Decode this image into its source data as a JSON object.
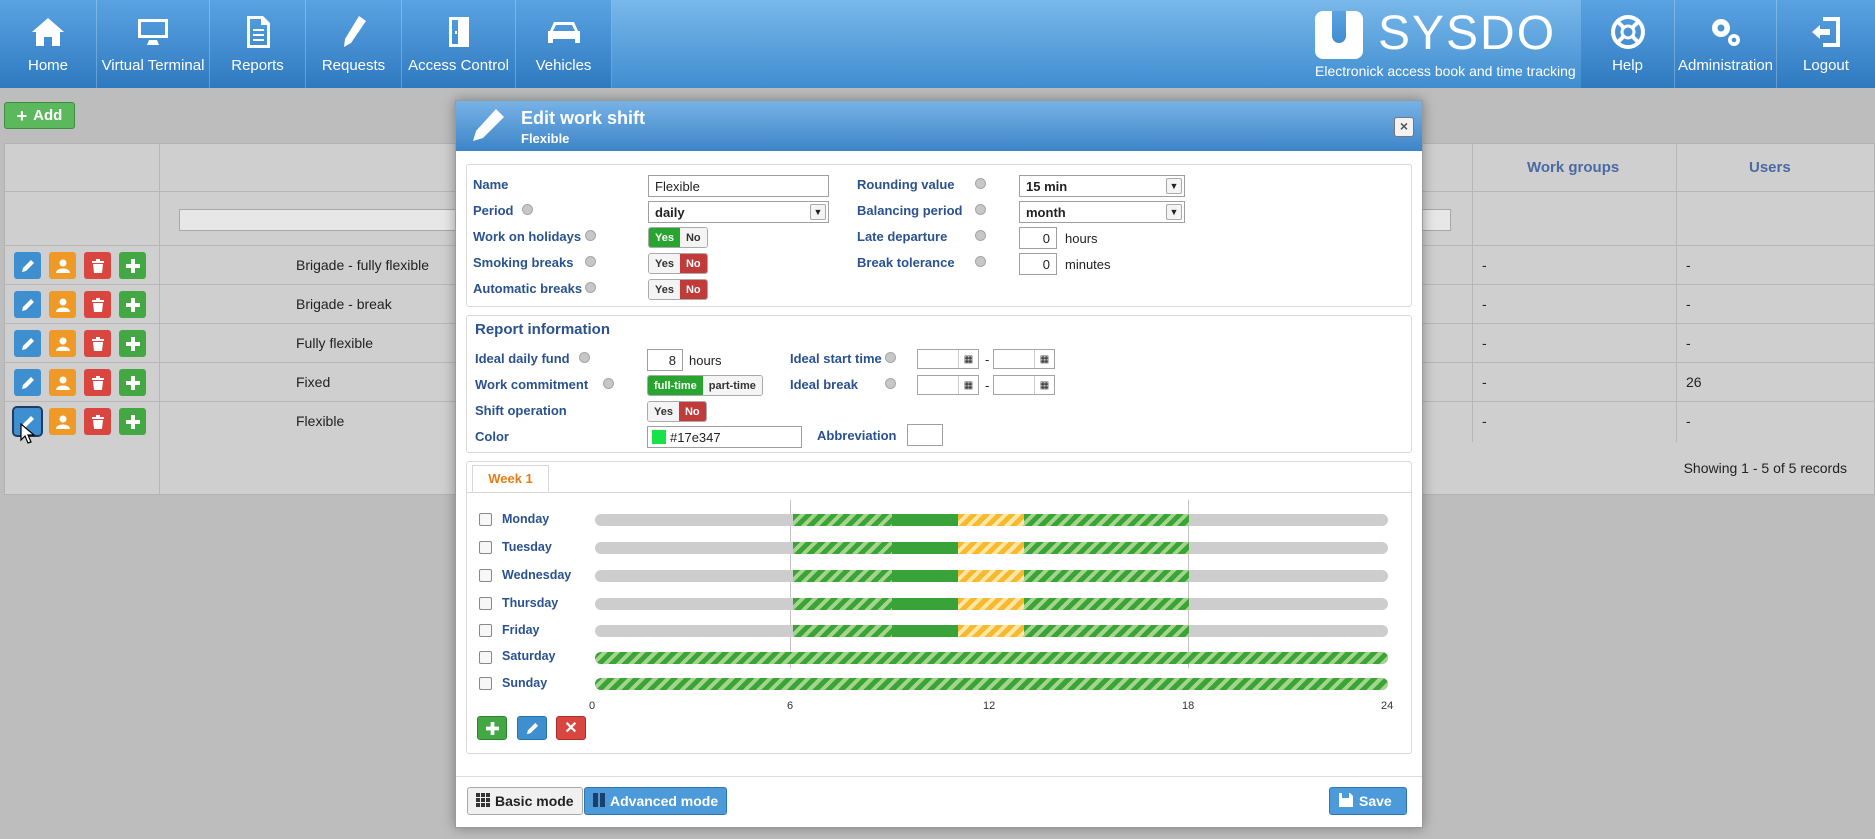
{
  "nav": {
    "items": [
      {
        "label": "Home",
        "icon": "home-icon"
      },
      {
        "label": "Virtual Terminal",
        "icon": "monitor-icon"
      },
      {
        "label": "Reports",
        "icon": "report-icon"
      },
      {
        "label": "Requests",
        "icon": "pencil-icon"
      },
      {
        "label": "Access Control",
        "icon": "door-icon"
      },
      {
        "label": "Vehicles",
        "icon": "car-icon"
      }
    ],
    "right_items": [
      {
        "label": "Help",
        "icon": "lifebuoy-icon"
      },
      {
        "label": "Administration",
        "icon": "gears-icon"
      },
      {
        "label": "Logout",
        "icon": "logout-icon"
      }
    ],
    "brand_name": "SYSDO",
    "brand_tagline": "Electronick access book and time tracking"
  },
  "background": {
    "add_label": "Add",
    "columns": {
      "work_groups": "Work groups",
      "users": "Users"
    },
    "rows": [
      {
        "name": "Brigade - fully flexible",
        "work_groups": "-",
        "users": "-"
      },
      {
        "name": "Brigade - break",
        "work_groups": "-",
        "users": "-"
      },
      {
        "name": "Fully flexible",
        "work_groups": "-",
        "users": "-"
      },
      {
        "name": "Fixed",
        "work_groups": "-",
        "users": "26"
      },
      {
        "name": "Flexible",
        "work_groups": "-",
        "users": "-"
      }
    ],
    "records": "Showing 1 - 5 of 5 records"
  },
  "modal": {
    "title": "Edit work shift",
    "subtitle": "Flexible",
    "close_label": "×",
    "form": {
      "name_label": "Name",
      "name_value": "Flexible",
      "period_label": "Period",
      "period_value": "daily",
      "holidays_label": "Work on holidays",
      "smoking_label": "Smoking breaks",
      "auto_breaks_label": "Automatic breaks",
      "rounding_label": "Rounding value",
      "rounding_value": "15 min",
      "balancing_label": "Balancing period",
      "balancing_value": "month",
      "late_label": "Late departure",
      "late_value": "0",
      "late_unit": "hours",
      "tolerance_label": "Break tolerance",
      "tolerance_value": "0",
      "tolerance_unit": "minutes",
      "yes": "Yes",
      "no": "No",
      "holidays_selected": "Yes",
      "smoking_selected": "No",
      "auto_breaks_selected": "No"
    },
    "report": {
      "title": "Report information",
      "fund_label": "Ideal daily fund",
      "fund_value": "8",
      "fund_unit": "hours",
      "commitment_label": "Work commitment",
      "full_time": "full-time",
      "part_time": "part-time",
      "commitment_selected": "full-time",
      "shift_op_label": "Shift operation",
      "shift_op_selected": "No",
      "color_label": "Color",
      "color_value": "#17e347",
      "start_label": "Ideal start time",
      "break_label": "Ideal break",
      "abbrev_label": "Abbreviation",
      "range_sep": "-"
    },
    "schedule": {
      "tab": "Week 1",
      "days": [
        "Monday",
        "Tuesday",
        "Wednesday",
        "Thursday",
        "Friday",
        "Saturday",
        "Sunday"
      ],
      "ticks": [
        "0",
        "6",
        "12",
        "18",
        "24"
      ]
    },
    "footer": {
      "basic": "Basic mode",
      "advanced": "Advanced mode",
      "save": "Save"
    }
  }
}
